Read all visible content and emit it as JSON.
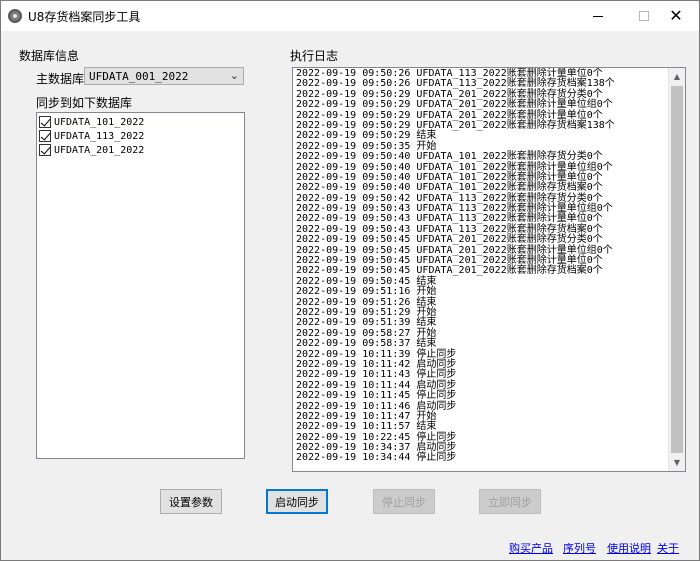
{
  "window": {
    "title": "U8存货档案同步工具",
    "minimize_icon": "minimize-icon",
    "maximize_icon": "maximize-icon",
    "close_symbol": "✕"
  },
  "db_info": {
    "group_label": "数据库信息",
    "main_db_label": "主数据库",
    "main_db_value": "UFDATA_001_2022",
    "sync_label": "同步到如下数据库",
    "targets": [
      {
        "name": "UFDATA_101_2022",
        "checked": true
      },
      {
        "name": "UFDATA_113_2022",
        "checked": true
      },
      {
        "name": "UFDATA_201_2022",
        "checked": true
      }
    ]
  },
  "log": {
    "label": "执行日志",
    "lines": [
      "2022-09-19 09:50:26 UFDATA_113_2022账套删除计量单位0个",
      "2022-09-19 09:50:26 UFDATA_113_2022账套删除存货档案138个",
      "2022-09-19 09:50:29 UFDATA_201_2022账套删除存货分类0个",
      "2022-09-19 09:50:29 UFDATA_201_2022账套删除计量单位组0个",
      "2022-09-19 09:50:29 UFDATA_201_2022账套删除计量单位0个",
      "2022-09-19 09:50:29 UFDATA_201_2022账套删除存货档案138个",
      "2022-09-19 09:50:29 结束",
      "2022-09-19 09:50:35 开始",
      "2022-09-19 09:50:40 UFDATA_101_2022账套删除存货分类0个",
      "2022-09-19 09:50:40 UFDATA_101_2022账套删除计量单位组0个",
      "2022-09-19 09:50:40 UFDATA_101_2022账套删除计量单位0个",
      "2022-09-19 09:50:40 UFDATA_101_2022账套删除存货档案0个",
      "2022-09-19 09:50:42 UFDATA_113_2022账套删除存货分类0个",
      "2022-09-19 09:50:43 UFDATA_113_2022账套删除计量单位组0个",
      "2022-09-19 09:50:43 UFDATA_113_2022账套删除计量单位0个",
      "2022-09-19 09:50:43 UFDATA_113_2022账套删除存货档案0个",
      "2022-09-19 09:50:45 UFDATA_201_2022账套删除存货分类0个",
      "2022-09-19 09:50:45 UFDATA_201_2022账套删除计量单位组0个",
      "2022-09-19 09:50:45 UFDATA_201_2022账套删除计量单位0个",
      "2022-09-19 09:50:45 UFDATA_201_2022账套删除存货档案0个",
      "2022-09-19 09:50:45 结束",
      "2022-09-19 09:51:16 开始",
      "2022-09-19 09:51:26 结束",
      "2022-09-19 09:51:29 开始",
      "2022-09-19 09:51:39 结束",
      "2022-09-19 09:58:27 开始",
      "2022-09-19 09:58:37 结束",
      "2022-09-19 10:11:39 停止同步",
      "2022-09-19 10:11:42 启动同步",
      "2022-09-19 10:11:43 停止同步",
      "2022-09-19 10:11:44 启动同步",
      "2022-09-19 10:11:45 停止同步",
      "2022-09-19 10:11:46 启动同步",
      "2022-09-19 10:11:47 开始",
      "2022-09-19 10:11:57 结束",
      "2022-09-19 10:22:45 停止同步",
      "2022-09-19 10:34:37 启动同步",
      "2022-09-19 10:34:44 停止同步"
    ]
  },
  "buttons": {
    "settings": "设置参数",
    "start_sync": "启动同步",
    "stop_sync": "停止同步",
    "sync_now": "立即同步"
  },
  "links": {
    "buy": "购买产品",
    "serial": "序列号",
    "help": "使用说明",
    "about": "关于"
  },
  "scroll": {
    "up_symbol": "▲",
    "down_symbol": "▼"
  }
}
